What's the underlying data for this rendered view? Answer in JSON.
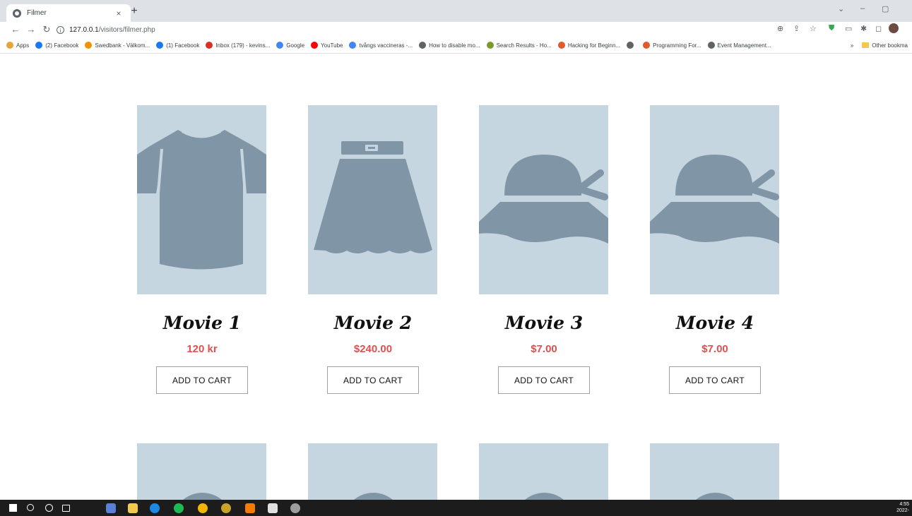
{
  "browser": {
    "tab_title": "Filmer",
    "tab_close": "×",
    "new_tab": "+",
    "url_host": "127.0.0.1",
    "url_path": "/visitors/filmer.php"
  },
  "bookmarks": {
    "items": [
      {
        "label": "Apps",
        "color": "#e8a33c"
      },
      {
        "label": "(2) Facebook",
        "color": "#1877f2"
      },
      {
        "label": "Swedbank - Välkom...",
        "color": "#f39200"
      },
      {
        "label": "(1) Facebook",
        "color": "#1877f2"
      },
      {
        "label": "Inbox (179) - kevins...",
        "color": "#d93025"
      },
      {
        "label": "Google",
        "color": "#4285f4"
      },
      {
        "label": "YouTube",
        "color": "#ff0000"
      },
      {
        "label": "tvångs vaccineras -...",
        "color": "#4285f4"
      },
      {
        "label": "How to disable mo...",
        "color": "#5f6368"
      },
      {
        "label": "Search Results - Ho...",
        "color": "#7a9a2e"
      },
      {
        "label": "Hacking for Beginn...",
        "color": "#e05a2b"
      },
      {
        "label": "",
        "color": "#5f6368"
      },
      {
        "label": "Programming For...",
        "color": "#e05a2b"
      },
      {
        "label": "Event Management...",
        "color": "#5f6368"
      }
    ],
    "more": "»",
    "other": "Other bookma"
  },
  "products": [
    {
      "name": "Movie 1",
      "price": "120 kr",
      "button": "ADD TO CART",
      "icon": "tshirt-icon"
    },
    {
      "name": "Movie 2",
      "price": "$240.00",
      "button": "ADD TO CART",
      "icon": "skirt-icon"
    },
    {
      "name": "Movie 3",
      "price": "$7.00",
      "button": "ADD TO CART",
      "icon": "hat-icon"
    },
    {
      "name": "Movie 4",
      "price": "$7.00",
      "button": "ADD TO CART",
      "icon": "hat-icon"
    }
  ],
  "colors": {
    "image_bg": "#c5d6e0",
    "icon_fill": "#8096a6",
    "price": "#e05050"
  },
  "taskbar": {
    "time": "4:55",
    "date": "2022-"
  }
}
